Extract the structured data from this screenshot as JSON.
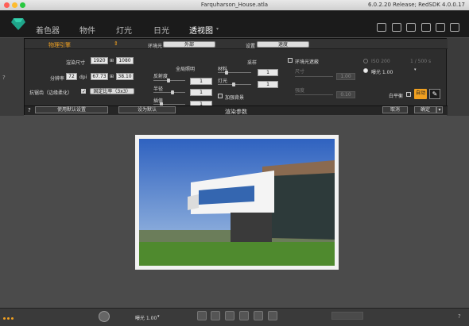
{
  "window": {
    "title": "Farquharson_House.atla",
    "version": "6.0.2.20 Release; RedSDK 4.0.0.17"
  },
  "nav": {
    "tabs": [
      "着色器",
      "物件",
      "灯光",
      "日光",
      "透视图"
    ],
    "active_index": 4
  },
  "panel": {
    "engine_label": "物理引擎",
    "env_label": "环境光",
    "env_value": "外部",
    "settings_label": "设置",
    "settings_value": "速度",
    "render_size_label": "渲染尺寸",
    "width": "1920",
    "height": "1080",
    "resolution_label": "分辨率",
    "dpi": "72",
    "dpi_unit": "dpi",
    "dim_w": "67.73",
    "dim_h": "38.10",
    "aa_label": "抗锯齿（边缘柔化）",
    "ratio_value": "固定比率（3x3）",
    "global_light_label": "全局照明",
    "bounce_label": "反射度",
    "radius_label": "半径",
    "sampling_label": "插值",
    "bounce_value": "1",
    "radius_value": "1",
    "sampling_value": "1",
    "material_label": "材料",
    "sample_label": "采样",
    "material_value": "1",
    "light_label": "灯光",
    "light_value": "1",
    "enhance_bg_label": "加强背景",
    "ao_label": "环境光遮蔽",
    "ao_size_label": "尺寸",
    "ao_size_value": "1.00",
    "ao_strength_label": "强度",
    "ao_strength_value": "0.10",
    "iso_label": "ISO 200",
    "shutter_label": "1 / 500 s",
    "exposure_label": "曝光 1.00",
    "white_balance_label": "白平衡",
    "auto_label": "自动",
    "use_default_label": "使用默认设置",
    "set_default_label": "设为默认",
    "render_params_label": "渲染参数",
    "cancel_label": "取消",
    "ok_label": "确定",
    "help_label": "?"
  },
  "bottom": {
    "exposure_label": "曝光 1.00"
  },
  "colors": {
    "accent": "#f0a020",
    "sky_top": "#3a6ec8",
    "grass": "#4f8a2e"
  }
}
